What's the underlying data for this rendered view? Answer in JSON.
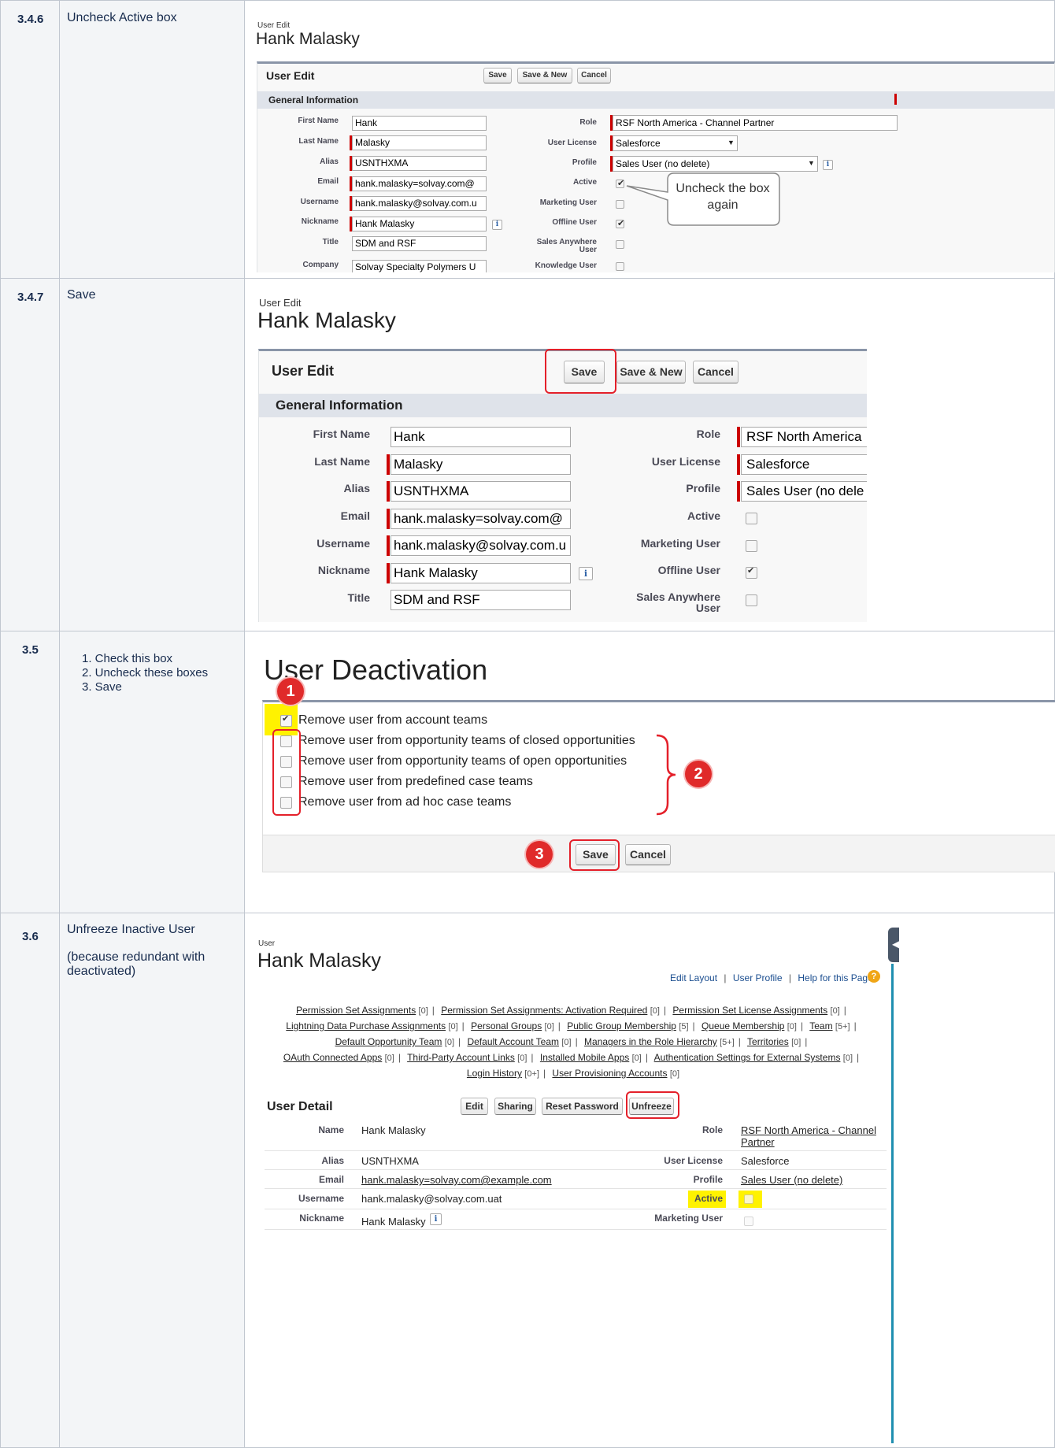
{
  "rows": [
    {
      "num": "3.4.6",
      "desc": "Uncheck Active box"
    },
    {
      "num": "3.4.7",
      "desc": "Save"
    },
    {
      "num": "3.5",
      "steps": [
        "1.  Check this box",
        "2.  Uncheck these boxes",
        "3.  Save"
      ]
    },
    {
      "num": "3.6",
      "desc": "Unfreeze Inactive User",
      "note": "(because redundant with deactivated)"
    }
  ],
  "user_edit": {
    "sub": "User Edit",
    "name": "Hank Malasky",
    "panel_title": "User Edit",
    "save": "Save",
    "save_new": "Save & New",
    "cancel": "Cancel",
    "section": "General Information",
    "labels": {
      "first_name": "First Name",
      "last_name": "Last Name",
      "alias": "Alias",
      "email": "Email",
      "username": "Username",
      "nickname": "Nickname",
      "title": "Title",
      "company": "Company",
      "role": "Role",
      "user_license": "User License",
      "profile": "Profile",
      "active": "Active",
      "marketing_user": "Marketing User",
      "offline_user": "Offline User",
      "sales_anywhere_1": "Sales Anywhere",
      "sales_anywhere_2": "User",
      "knowledge_user": "Knowledge User"
    },
    "values": {
      "first_name": "Hank",
      "last_name": "Malasky",
      "alias": "USNTHXMA",
      "email": "hank.malasky=solvay.com@",
      "username": "hank.malasky@solvay.com.u",
      "nickname": "Hank Malasky",
      "title": "SDM and RSF",
      "company": "Solvay Specialty Polymers U",
      "role": "RSF North America - Channel Partner",
      "user_license": "Salesforce",
      "profile": "Sales User (no delete)",
      "role_trunc": "RSF North America",
      "profile_trunc": "Sales User (no dele"
    },
    "checkboxes_346": {
      "active": true,
      "marketing_user": false,
      "offline_user": true,
      "sales_anywhere": false,
      "knowledge_user": false
    },
    "checkboxes_347": {
      "active": false,
      "marketing_user": false,
      "offline_user": true,
      "sales_anywhere": false
    },
    "callout": "Uncheck the box again",
    "info_glyph": "i",
    "dropdown_glyph": "▼"
  },
  "deactivation": {
    "title": "User Deactivation",
    "options": [
      {
        "label": "Remove user from account teams",
        "checked": true
      },
      {
        "label": "Remove user from opportunity teams of closed opportunities",
        "checked": false
      },
      {
        "label": "Remove user from opportunity teams of open opportunities",
        "checked": false
      },
      {
        "label": "Remove user from predefined case teams",
        "checked": false
      },
      {
        "label": "Remove user from ad hoc case teams",
        "checked": false
      }
    ],
    "save": "Save",
    "cancel": "Cancel",
    "badges": [
      "1",
      "2",
      "3"
    ]
  },
  "user_detail": {
    "sub": "User",
    "name": "Hank Malasky",
    "top_links": [
      "Edit Layout",
      "User Profile",
      "Help for this Page"
    ],
    "related_lines": [
      [
        {
          "text": "Permission Set Assignments",
          "count": "[0]"
        },
        {
          "text": "Permission Set Assignments: Activation Required",
          "count": "[0]"
        },
        {
          "text": "Permission Set License Assignments",
          "count": "[0]"
        }
      ],
      [
        {
          "text": "Lightning Data Purchase Assignments",
          "count": "[0]"
        },
        {
          "text": "Personal Groups",
          "count": "[0]"
        },
        {
          "text": "Public Group Membership",
          "count": "[5]"
        },
        {
          "text": "Queue Membership",
          "count": "[0]"
        },
        {
          "text": "Team",
          "count": "[5+]"
        }
      ],
      [
        {
          "text": "Default Opportunity Team",
          "count": "[0]"
        },
        {
          "text": "Default Account Team",
          "count": "[0]"
        },
        {
          "text": "Managers in the Role Hierarchy",
          "count": "[5+]"
        },
        {
          "text": "Territories",
          "count": "[0]"
        }
      ],
      [
        {
          "text": "OAuth Connected Apps",
          "count": "[0]"
        },
        {
          "text": "Third-Party Account Links",
          "count": "[0]"
        },
        {
          "text": "Installed Mobile Apps",
          "count": "[0]"
        },
        {
          "text": "Authentication Settings for External Systems",
          "count": "[0]"
        }
      ],
      [
        {
          "text": "Login History",
          "count": "[0+]"
        },
        {
          "text": "User Provisioning Accounts",
          "count": "[0]"
        }
      ]
    ],
    "panel_title": "User Detail",
    "buttons": [
      "Edit",
      "Sharing",
      "Reset Password",
      "Unfreeze"
    ],
    "fields_left": [
      {
        "label": "Name",
        "value": "Hank Malasky"
      },
      {
        "label": "Alias",
        "value": "USNTHXMA"
      },
      {
        "label": "Email",
        "value": "hank.malasky=solvay.com@example.com"
      },
      {
        "label": "Username",
        "value": "hank.malasky@solvay.com.uat"
      },
      {
        "label": "Nickname",
        "value": "Hank Malasky"
      }
    ],
    "fields_right": [
      {
        "label": "Role",
        "value_1": "RSF North America - Channel",
        "value_2": "Partner"
      },
      {
        "label": "User License",
        "value": "Salesforce"
      },
      {
        "label": "Profile",
        "value": "Sales User (no delete)"
      },
      {
        "label": "Active",
        "checked": false
      },
      {
        "label": "Marketing User",
        "checked": false
      }
    ]
  },
  "colors": {
    "highlight_red": "#e4202a",
    "yellow_highlight": "#fff200",
    "required_red": "#cc0000",
    "table_header_bg": "#f3f5f7"
  }
}
